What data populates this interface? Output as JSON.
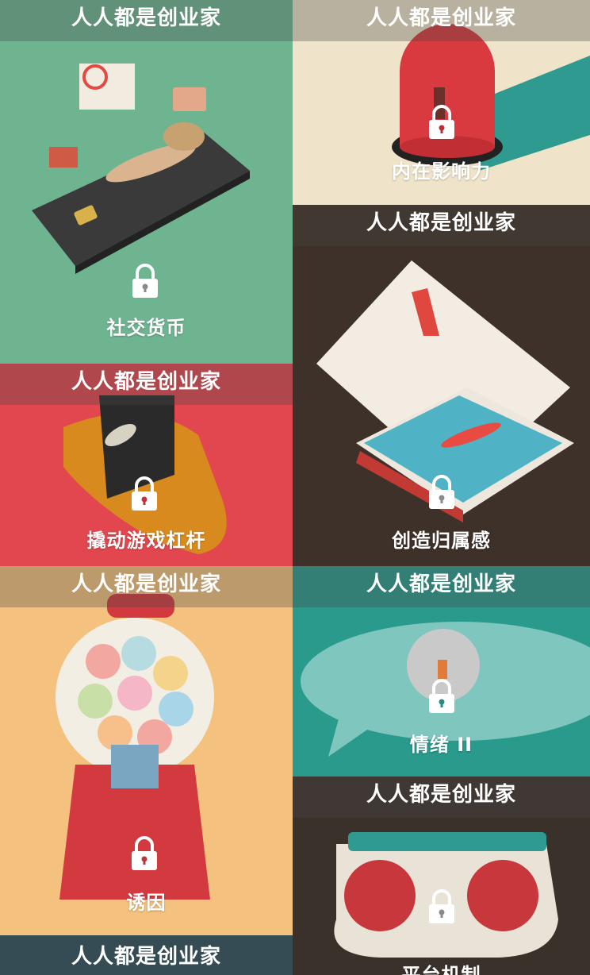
{
  "cards": [
    {
      "banner": "人人都是创业家",
      "title": "社交货币",
      "bg": "#6fb491"
    },
    {
      "banner": "人人都是创业家",
      "title": "内在影响力",
      "bg": "#efe3c9"
    },
    {
      "banner": "人人都是创业家",
      "title": "",
      "bg": "#3e3129"
    },
    {
      "banner": "人人都是创业家",
      "title": "撬动游戏杠杆",
      "bg": "#e2474f"
    },
    {
      "banner": "人人都是创业家",
      "title": "创造归属感",
      "bg": "#3e3129"
    },
    {
      "banner": "人人都是创业家",
      "title": "诱因",
      "bg": "#f4c27e"
    },
    {
      "banner": "人人都是创业家",
      "title": "情绪 II",
      "bg": "#2a9a8d"
    },
    {
      "banner": "人人都是创业家",
      "title": "平台机制",
      "bg": "#3b312b"
    },
    {
      "banner": "人人都是创业家",
      "title": "",
      "bg": "#2f4f5a"
    }
  ],
  "icons": {
    "lock": "lock-icon"
  }
}
